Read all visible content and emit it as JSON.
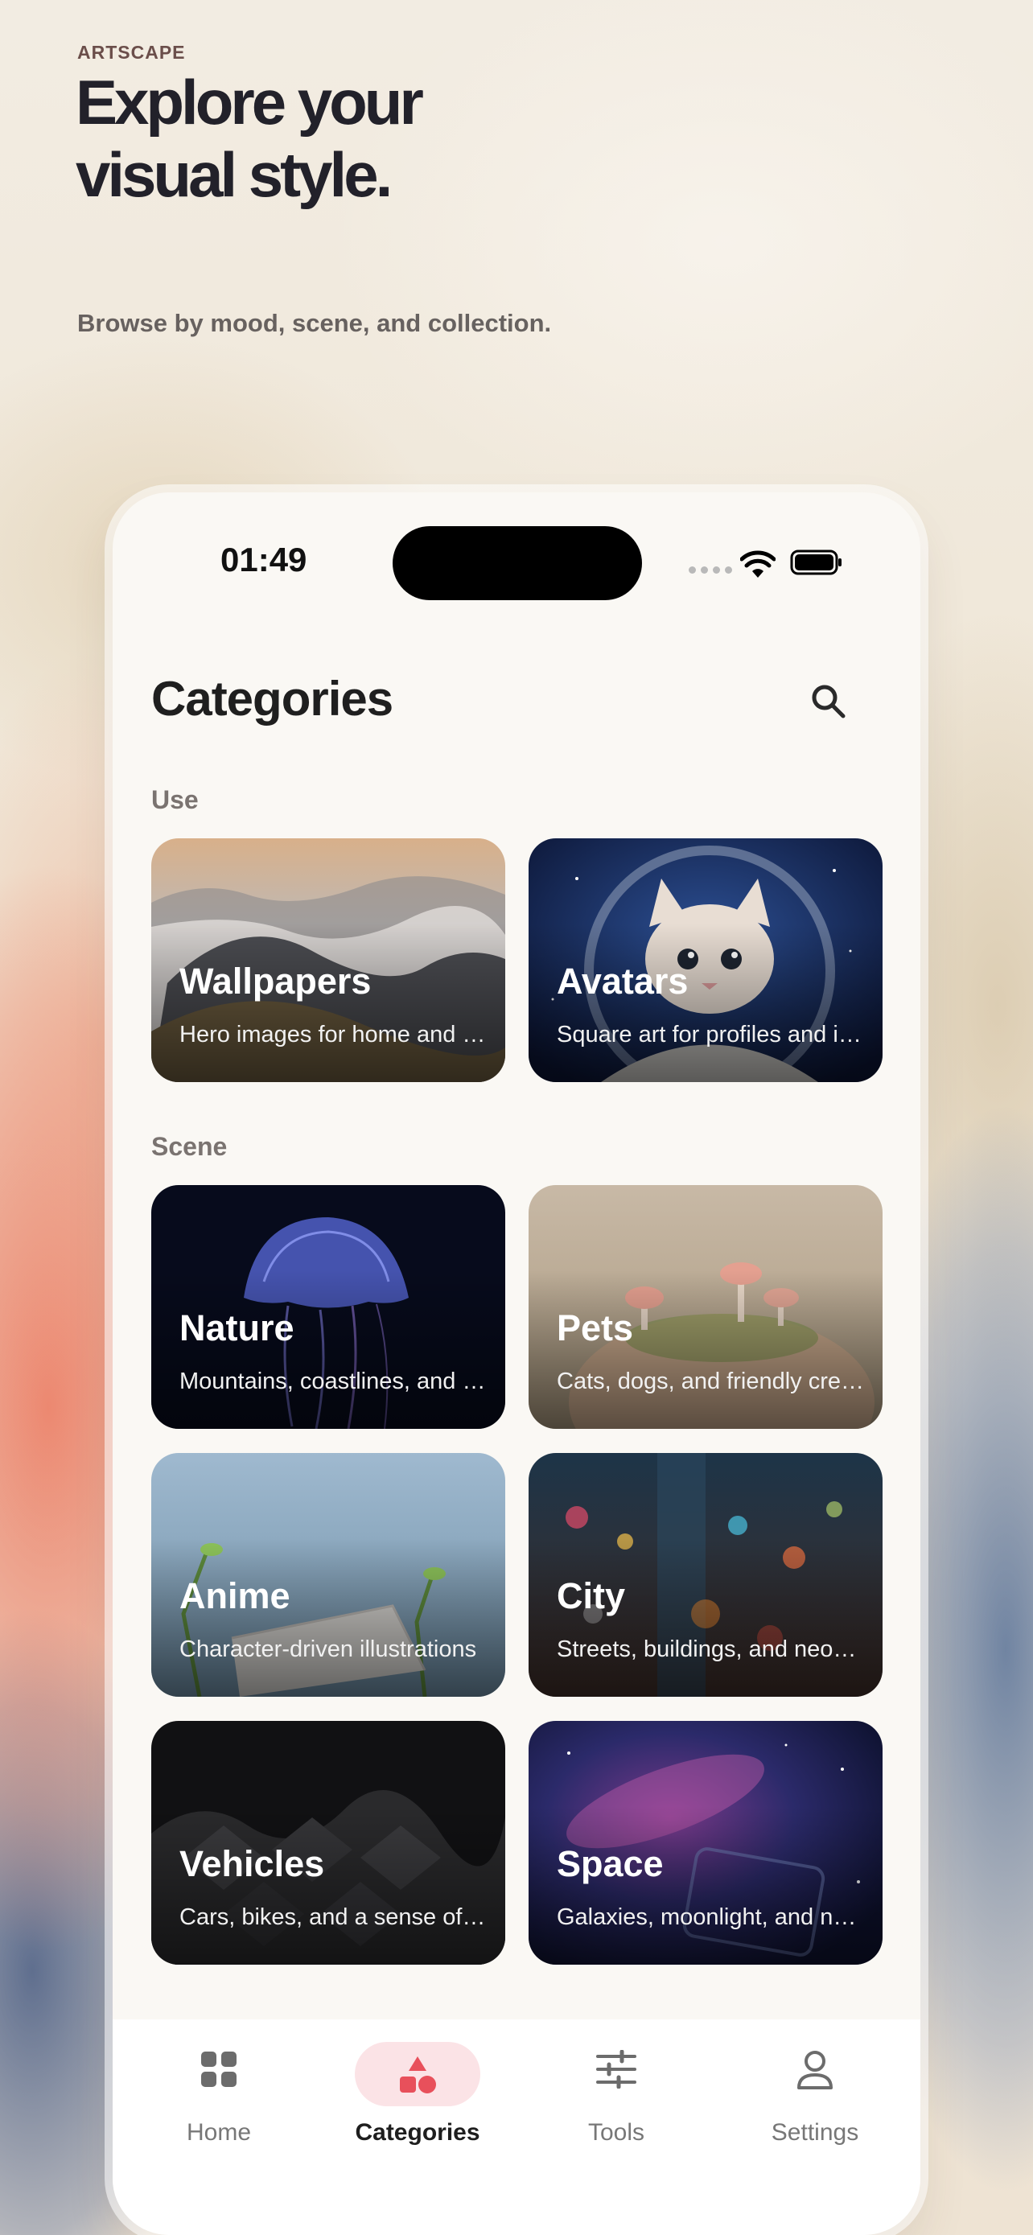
{
  "marketing": {
    "brand": "ARTSCAPE",
    "headline": "Explore your visual style.",
    "subline": "Browse by mood, scene, and collection."
  },
  "status_bar": {
    "time": "01:49"
  },
  "header": {
    "title": "Categories",
    "search_icon": "search-icon"
  },
  "sections": [
    {
      "label": "Use",
      "cards": [
        {
          "title": "Wallpapers",
          "description": "Hero images for home and lock screens"
        },
        {
          "title": "Avatars",
          "description": "Square art for profiles and icons"
        }
      ]
    },
    {
      "label": "Scene",
      "cards": [
        {
          "title": "Nature",
          "description": "Mountains, coastlines, and forests"
        },
        {
          "title": "Pets",
          "description": "Cats, dogs, and friendly creatures"
        },
        {
          "title": "Anime",
          "description": "Character-driven illustrations"
        },
        {
          "title": "City",
          "description": "Streets, buildings, and neon lights"
        },
        {
          "title": "Vehicles",
          "description": "Cars, bikes, and a sense of speed"
        },
        {
          "title": "Space",
          "description": "Galaxies, moonlight, and nebulae"
        }
      ]
    }
  ],
  "tabs": [
    {
      "label": "Home",
      "icon": "grid-icon",
      "active": false
    },
    {
      "label": "Categories",
      "icon": "shapes-icon",
      "active": true
    },
    {
      "label": "Tools",
      "icon": "sliders-icon",
      "active": false
    },
    {
      "label": "Settings",
      "icon": "person-icon",
      "active": false
    }
  ],
  "colors": {
    "accent": "#e8505b",
    "accent_soft": "#fbe3e6",
    "text_primary": "#1f1f1f"
  }
}
